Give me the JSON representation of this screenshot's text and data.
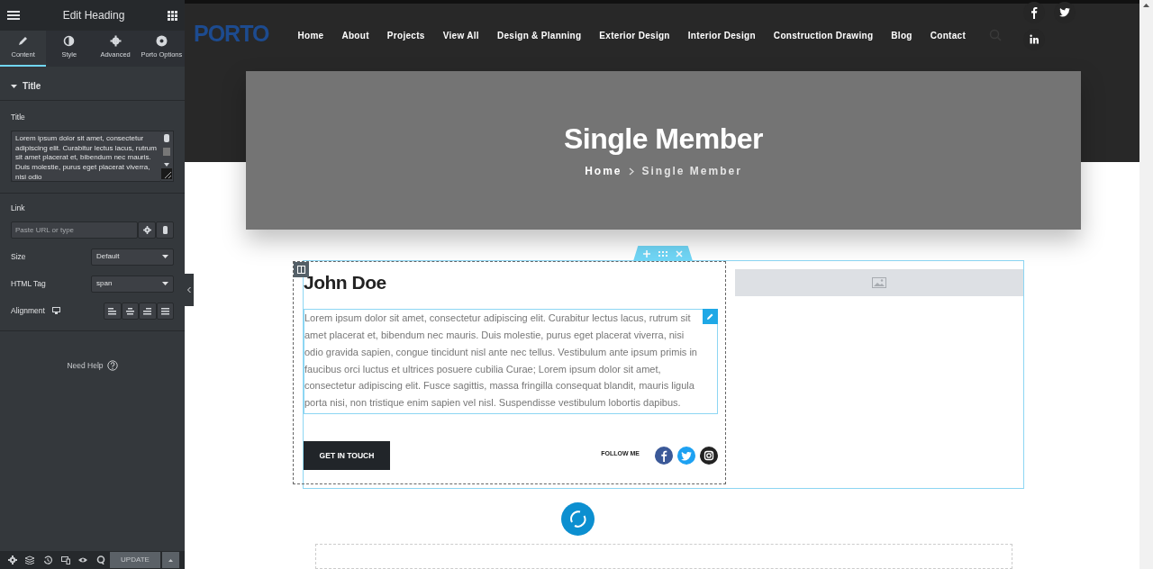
{
  "panel": {
    "title": "Edit Heading",
    "tabs": [
      {
        "label": "Content",
        "selected": true
      },
      {
        "label": "Style",
        "selected": false
      },
      {
        "label": "Advanced",
        "selected": false
      },
      {
        "label": "Porto Options",
        "selected": false
      }
    ],
    "section": {
      "title": "Title",
      "expanded": true
    },
    "title_field": {
      "label": "Title",
      "value": "Lorem ipsum dolor sit amet, consectetur adipiscing elit. Curabitur lectus lacus, rutrum sit amet placerat et, bibendum nec mauris. Duis molestie, purus eget placerat viverra, nisi odio"
    },
    "link_field": {
      "label": "Link",
      "placeholder": "Paste URL or type"
    },
    "size": {
      "label": "Size",
      "value": "Default"
    },
    "html_tag": {
      "label": "HTML Tag",
      "value": "span"
    },
    "alignment": {
      "label": "Alignment"
    },
    "help": "Need Help",
    "update_button": "UPDATE"
  },
  "site": {
    "logo": "PORTO",
    "nav": [
      "Home",
      "About",
      "Projects",
      "View All",
      "Design & Planning",
      "Exterior Design",
      "Interior Design",
      "Construction Drawing",
      "Blog",
      "Contact"
    ],
    "hero": {
      "title": "Single Member",
      "breadcrumb": [
        "Home",
        "Single Member"
      ]
    },
    "member": {
      "name": "John Doe",
      "bio": "Lorem ipsum dolor sit amet, consectetur adipiscing elit. Curabitur lectus lacus, rutrum sit amet placerat et, bibendum nec mauris. Duis molestie, purus eget placerat viverra, nisi odio gravida sapien, congue tincidunt nisl ante nec tellus. Vestibulum ante ipsum primis in faucibus orci luctus et ultrices posuere cubilia Curae; Lorem ipsum dolor sit amet, consectetur adipiscing elit. Fusce sagittis, massa fringilla consequat blandit, mauris ligula porta nisi, non tristique enim sapien vel nisl. Suspendisse vestibulum lobortis dapibus.",
      "button": "GET IN TOUCH",
      "follow_label": "FOLLOW ME"
    }
  }
}
